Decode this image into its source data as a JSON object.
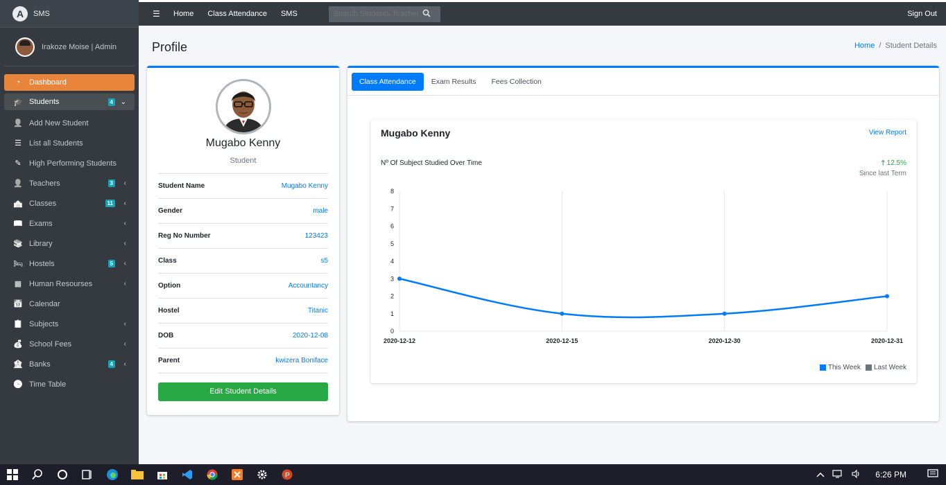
{
  "brand": {
    "logo": "A",
    "name": "SMS"
  },
  "user": {
    "name": "Irakoze Moise | Admin"
  },
  "sidebar": {
    "items": [
      {
        "label": "Dashboard",
        "icon": "dashboard-icon",
        "badge": "",
        "chevron": ""
      },
      {
        "label": "Students",
        "icon": "user-graduate-icon",
        "badge": "4",
        "chevron": "⌄"
      },
      {
        "label": "Add New Student",
        "icon": "user-plus-icon",
        "badge": "",
        "chevron": ""
      },
      {
        "label": "List all Students",
        "icon": "list-icon",
        "badge": "",
        "chevron": ""
      },
      {
        "label": "High Performing Students",
        "icon": "pen-icon",
        "badge": "",
        "chevron": ""
      },
      {
        "label": "Teachers",
        "icon": "user-icon",
        "badge": "3",
        "chevron": "‹"
      },
      {
        "label": "Classes",
        "icon": "school-icon",
        "badge": "11",
        "chevron": "‹"
      },
      {
        "label": "Exams",
        "icon": "book-open-icon",
        "badge": "",
        "chevron": "‹"
      },
      {
        "label": "Library",
        "icon": "book-reader-icon",
        "badge": "",
        "chevron": "‹"
      },
      {
        "label": "Hostels",
        "icon": "bed-icon",
        "badge": "5",
        "chevron": "‹"
      },
      {
        "label": "Human Resourses",
        "icon": "table-icon",
        "badge": "",
        "chevron": "‹"
      },
      {
        "label": "Calendar",
        "icon": "calendar-icon",
        "badge": "",
        "chevron": ""
      },
      {
        "label": "Subjects",
        "icon": "clipboard-icon",
        "badge": "",
        "chevron": "‹"
      },
      {
        "label": "School Fees",
        "icon": "money-icon",
        "badge": "",
        "chevron": "‹"
      },
      {
        "label": "Banks",
        "icon": "bank-icon",
        "badge": "4",
        "chevron": "‹"
      },
      {
        "label": "Time Table",
        "icon": "clock-icon",
        "badge": "",
        "chevron": ""
      }
    ]
  },
  "topbar": {
    "links": [
      "Home",
      "Class Attendance",
      "SMS"
    ],
    "search_placeholder": "Search Students,Teachers",
    "signout": "Sign Out"
  },
  "page": {
    "title": "Profile",
    "breadcrumb_home": "Home",
    "breadcrumb_current": "Student Details"
  },
  "profile": {
    "name": "Mugabo Kenny",
    "role": "Student",
    "fields": [
      {
        "label": "Student Name",
        "value": "Mugabo Kenny"
      },
      {
        "label": "Gender",
        "value": "male"
      },
      {
        "label": "Reg No Number",
        "value": "123423"
      },
      {
        "label": "Class",
        "value": "s5"
      },
      {
        "label": "Option",
        "value": "Accountancy"
      },
      {
        "label": "Hostel",
        "value": "Titanic"
      },
      {
        "label": "DOB",
        "value": "2020-12-08"
      },
      {
        "label": "Parent",
        "value": "kwizera Boniface"
      }
    ],
    "edit_button": "Edit Student Details"
  },
  "tabs": [
    "Class Attendance",
    "Exam Results",
    "Fees Collection"
  ],
  "chart_card": {
    "title": "Mugabo Kenny",
    "view_report": "View Report",
    "subtitle": "Nº Of Subject Studied Over Time",
    "growth": "12.5%",
    "growth_note": "Since last Term"
  },
  "colors": {
    "accent": "#007bff",
    "active_nav": "#e8853a",
    "success": "#28a745",
    "sidebar": "#343a40",
    "last_week": "#6c757d"
  },
  "chart_data": {
    "type": "line",
    "categories": [
      "2020-12-12",
      "2020-12-15",
      "2020-12-30",
      "2020-12-31"
    ],
    "series": [
      {
        "name": "This Week",
        "values": [
          3,
          1,
          1,
          2
        ],
        "color": "#007bff"
      },
      {
        "name": "Last Week",
        "values": [],
        "color": "#6c757d"
      }
    ],
    "ylim": [
      0,
      8
    ],
    "yticks": [
      0,
      1,
      2,
      3,
      4,
      5,
      6,
      7,
      8
    ],
    "legend": "bottom-right",
    "grid": "vertical"
  },
  "taskbar": {
    "time": "6:26 PM"
  }
}
